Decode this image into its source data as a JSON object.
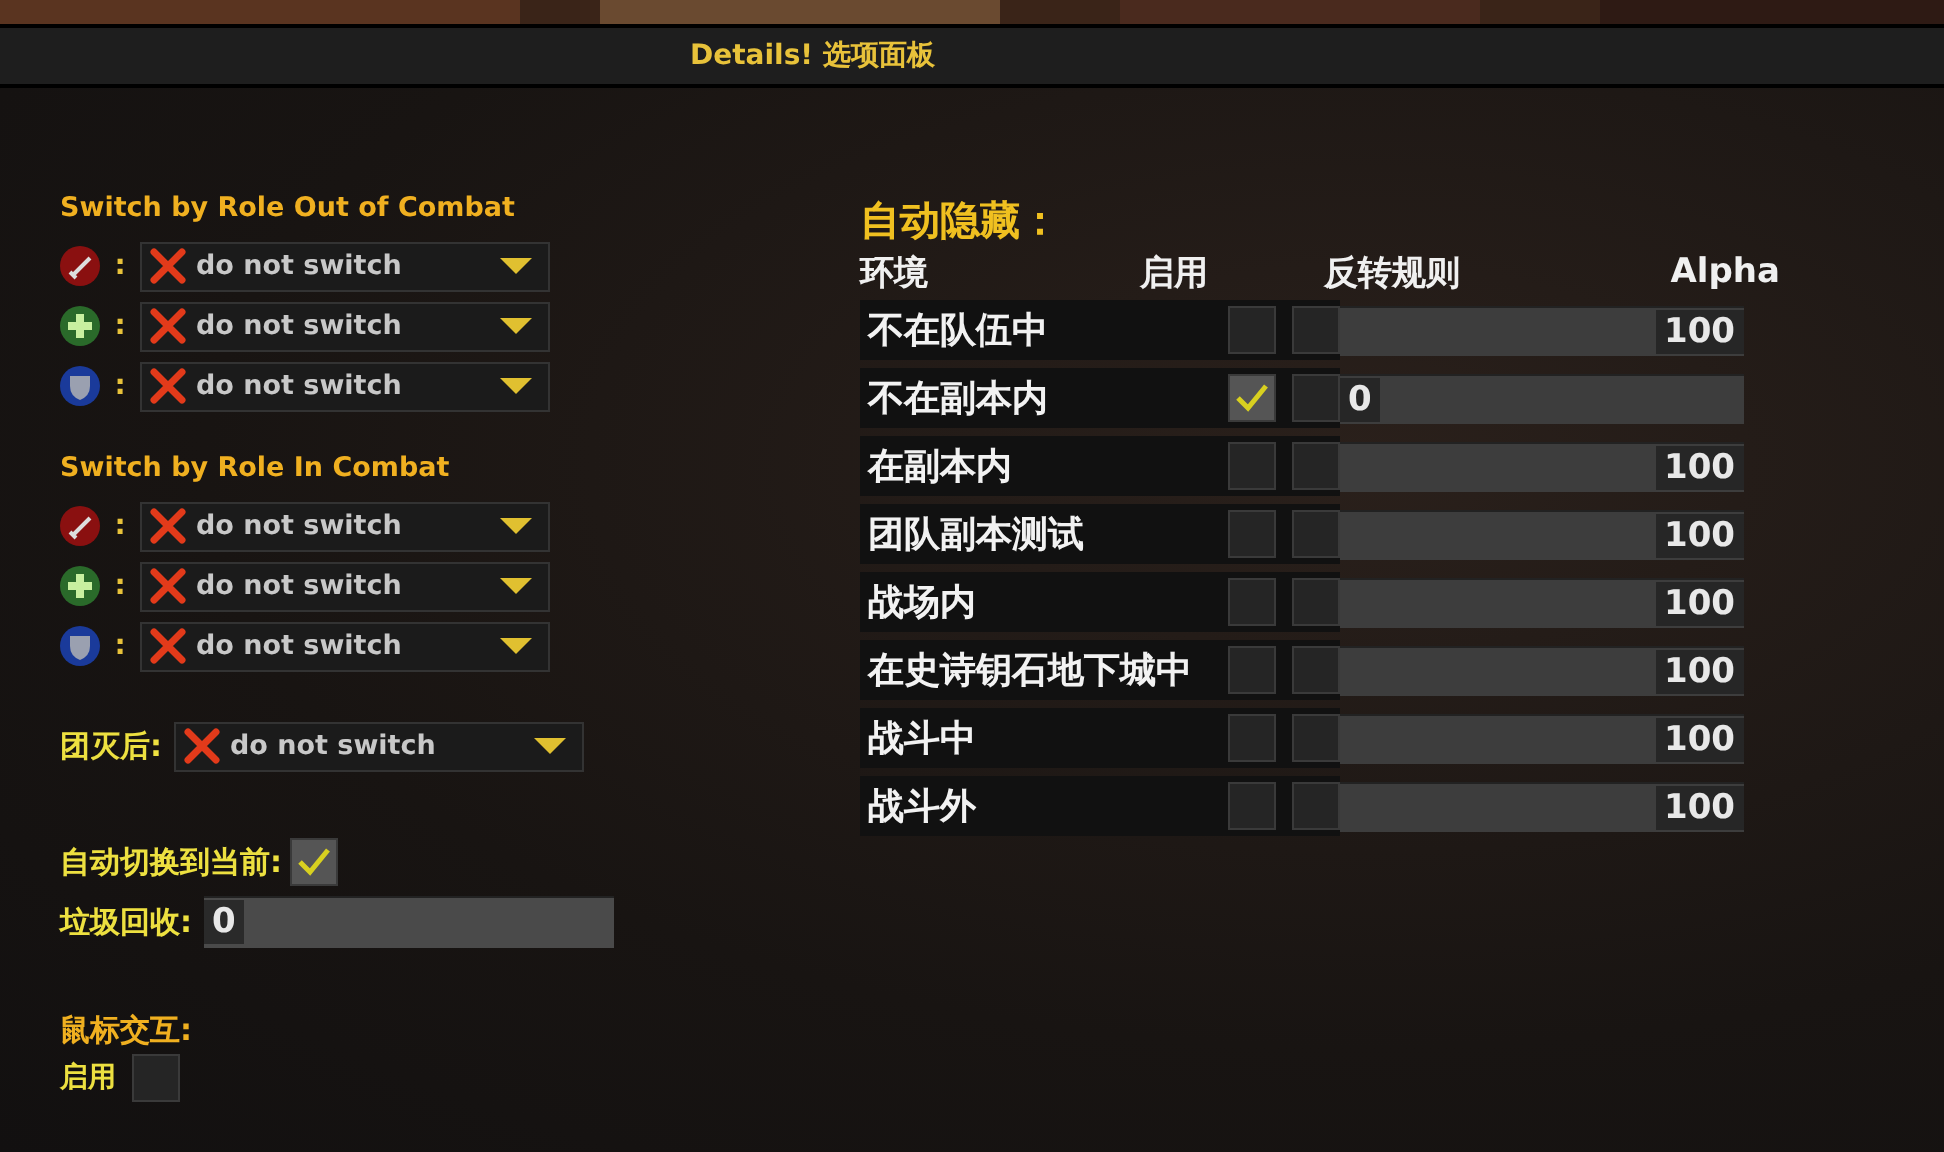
{
  "title": "Details! 选项面板",
  "role_sections": [
    {
      "heading": "Switch by Role Out of Combat",
      "rows": [
        {
          "kind": "damage",
          "separator": ":",
          "value": "do not switch"
        },
        {
          "kind": "healer",
          "separator": ":",
          "value": "do not switch"
        },
        {
          "kind": "tank",
          "separator": ":",
          "value": "do not switch"
        }
      ]
    },
    {
      "heading": "Switch by Role In Combat",
      "rows": [
        {
          "kind": "damage",
          "separator": ":",
          "value": "do not switch"
        },
        {
          "kind": "healer",
          "separator": ":",
          "value": "do not switch"
        },
        {
          "kind": "tank",
          "separator": ":",
          "value": "do not switch"
        }
      ]
    }
  ],
  "wipe": {
    "label": "团灭后:",
    "value": "do not switch"
  },
  "auto_switch": {
    "label": "自动切换到当前:",
    "checked": true
  },
  "garbage": {
    "label": "垃圾回收:",
    "value": "0",
    "level": 0
  },
  "mouse": {
    "heading": "鼠标交互:",
    "enable_label": "启用",
    "checked": false
  },
  "auto_hide": {
    "heading": "自动隐藏：",
    "columns": [
      "环境",
      "启用",
      "反转规则",
      "Alpha"
    ],
    "rows": [
      {
        "label": "不在队伍中",
        "enabled": false,
        "inverted": false,
        "alpha": "100",
        "level": 1
      },
      {
        "label": "不在副本内",
        "enabled": true,
        "inverted": false,
        "alpha": "0",
        "level": 0
      },
      {
        "label": "在副本内",
        "enabled": false,
        "inverted": false,
        "alpha": "100",
        "level": 1
      },
      {
        "label": "团队副本测试",
        "enabled": false,
        "inverted": false,
        "alpha": "100",
        "level": 1
      },
      {
        "label": "战场内",
        "enabled": false,
        "inverted": false,
        "alpha": "100",
        "level": 1
      },
      {
        "label": "在史诗钥石地下城中",
        "enabled": false,
        "inverted": false,
        "alpha": "100",
        "level": 1
      },
      {
        "label": "战斗中",
        "enabled": false,
        "inverted": false,
        "alpha": "100",
        "level": 1
      },
      {
        "label": "战斗外",
        "enabled": false,
        "inverted": false,
        "alpha": "100",
        "level": 1
      }
    ]
  }
}
